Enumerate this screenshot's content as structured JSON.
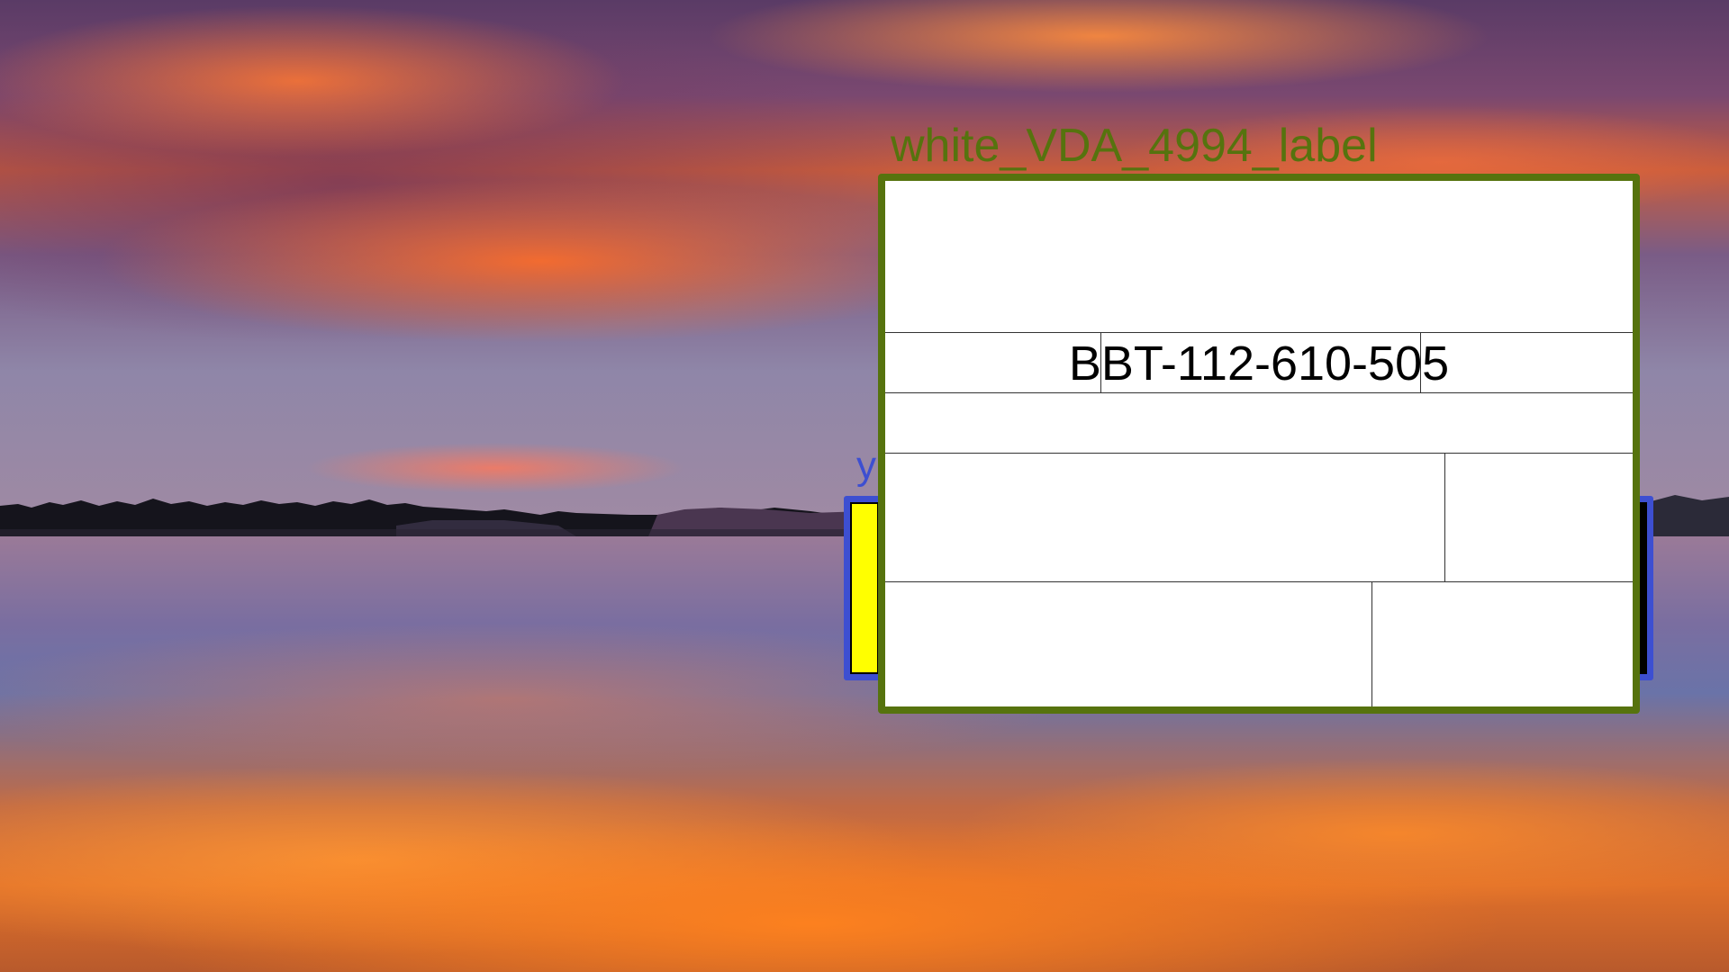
{
  "white_label": {
    "caption": "white_VDA_4994_label",
    "tracking_number": "BBT-112-610-505",
    "border_color": "#56730e"
  },
  "yellow_box": {
    "label": "y",
    "border_color": "#3d4fd1",
    "fill_color": "#ffff00"
  },
  "background": {
    "scene": "sunset over lake"
  }
}
